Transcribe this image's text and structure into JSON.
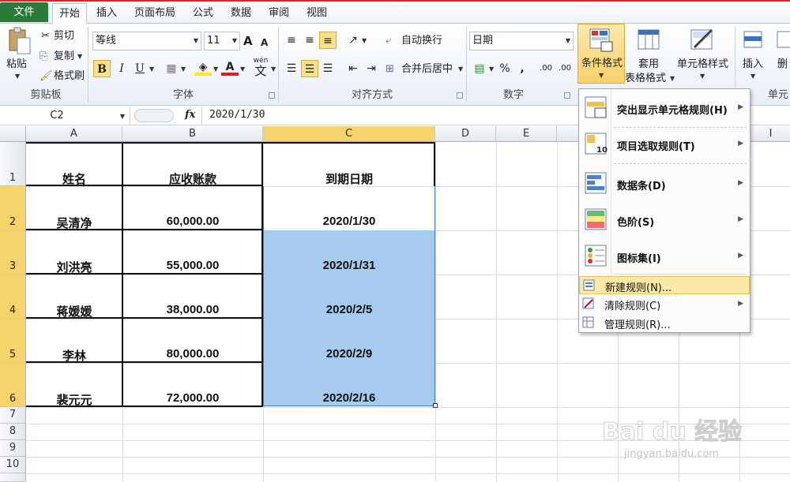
{
  "tabs": {
    "file": "文件",
    "home": "开始",
    "insert": "插入",
    "layout": "页面布局",
    "formulas": "公式",
    "data": "数据",
    "review": "审阅",
    "view": "视图"
  },
  "ribbon": {
    "clipboard": {
      "paste": "粘贴",
      "cut": "剪切",
      "copy": "复制",
      "format_painter": "格式刷",
      "label": "剪贴板"
    },
    "font": {
      "name": "等线",
      "size": "11",
      "bold": "B",
      "italic": "I",
      "underline": "U",
      "label": "字体",
      "grow": "A",
      "shrink": "A",
      "pinyin": "wén"
    },
    "alignment": {
      "wrap": "自动换行",
      "merge": "合并后居中",
      "label": "对齐方式"
    },
    "number": {
      "format": "日期",
      "percent": "%",
      "comma": ",",
      "inc_decimal": ".00",
      "dec_decimal": ".00",
      "label": "数字"
    },
    "styles": {
      "conditional": "条件格式",
      "table_format_1": "套用",
      "table_format_2": "表格格式",
      "cell_styles": "单元格样式",
      "label": ""
    },
    "cells": {
      "insert": "插入",
      "delete": "删",
      "label": "单元"
    }
  },
  "formula_bar": {
    "name_box": "C2",
    "fx": "fx",
    "content": "2020/1/30"
  },
  "columns": [
    "A",
    "B",
    "C",
    "D",
    "E",
    "F",
    "G",
    "H",
    "I"
  ],
  "rows": [
    "1",
    "2",
    "3",
    "4",
    "5",
    "6",
    "7",
    "8",
    "9",
    "10"
  ],
  "table": {
    "headers": [
      "姓名",
      "应收账款",
      "到期日期"
    ],
    "rows": [
      [
        "吴清净",
        "60,000.00",
        "2020/1/30"
      ],
      [
        "刘洪亮",
        "55,000.00",
        "2020/1/31"
      ],
      [
        "蒋媛媛",
        "38,000.00",
        "2020/2/5"
      ],
      [
        "李林",
        "80,000.00",
        "2020/2/9"
      ],
      [
        "裴元元",
        "72,000.00",
        "2020/2/16"
      ]
    ]
  },
  "menu": {
    "items": [
      {
        "label": "突出显示单元格规则(H)",
        "icon": "highlight-rules-icon"
      },
      {
        "label": "项目选取规则(T)",
        "icon": "top-bottom-rules-icon"
      },
      {
        "label": "数据条(D)",
        "icon": "data-bars-icon"
      },
      {
        "label": "色阶(S)",
        "icon": "color-scales-icon"
      },
      {
        "label": "图标集(I)",
        "icon": "icon-sets-icon"
      }
    ],
    "small_items": [
      {
        "label": "新建规则(N)...",
        "icon": "new-rule-icon"
      },
      {
        "label": "清除规则(C)",
        "icon": "clear-rules-icon"
      },
      {
        "label": "管理规则(R)...",
        "icon": "manage-rules-icon"
      }
    ]
  },
  "watermark": {
    "brand": "Bai du 经验",
    "url": "jingyan.baidu.com"
  },
  "colors": {
    "selection": "#a6cbee",
    "header_highlight": "#f6d36b",
    "menu_hover": "#fce9a8",
    "file_tab": "#2a7a3a"
  }
}
